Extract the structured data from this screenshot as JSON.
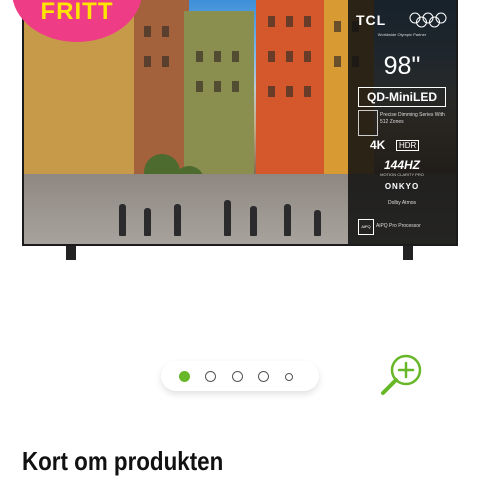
{
  "badge": {
    "text": "FRITT",
    "background": "#ef3c86",
    "text_color": "#ffe500"
  },
  "tv_image": {
    "brand": "TCL",
    "partner": "Worldwide Olympic Partner",
    "size": "98\"",
    "panel": "QD-MiniLED",
    "dimming": "Precise Dimming Series With 512 Zones",
    "resolution": "4K",
    "hdr": "HDR",
    "refresh": "144HZ",
    "motion": "MOTION CLARITY PRO",
    "audio_brand": "ONKYO",
    "dolby": "Dolby Atmos",
    "aipq_badge": "AiPQ",
    "processor": "AiPQ Pro Processor"
  },
  "gallery": {
    "dot_count": 5,
    "active_index": 0,
    "accent_color": "#67b729",
    "zoom_icon": "zoom-in-icon"
  },
  "section": {
    "heading": "Kort om produkten"
  }
}
